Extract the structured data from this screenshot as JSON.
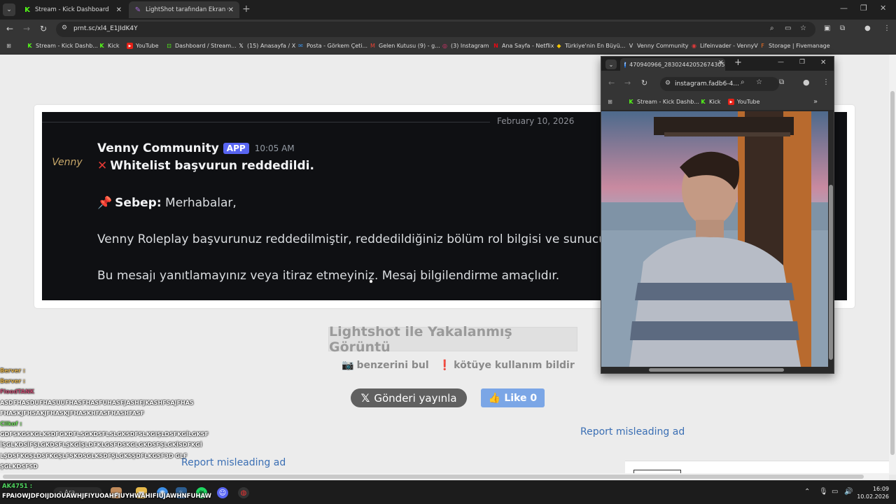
{
  "browser": {
    "tabs": [
      {
        "label": "Stream - Kick Dashboard"
      },
      {
        "label": "LightShot tarafından Ekran Görü"
      }
    ],
    "url": "prnt.sc/xl4_E1JIdK4Y",
    "bookmarks": [
      "Stream - Kick Dashb...",
      "Kick",
      "YouTube",
      "Dashboard / Stream...",
      "(15) Anasayfa / X",
      "Posta - Görkem Çeti...",
      "Gelen Kutusu (9) - g...",
      "(3) Instagram",
      "Ana Sayfa - Netflix",
      "Türkiye'nin En Büyü...",
      "Venny Community",
      "Lifeinvader - VennyV",
      "Storage | Fivemanage"
    ]
  },
  "screenshot": {
    "date": "February 10, 2026",
    "author": "Venny Community",
    "app_badge": "APP",
    "time": "10:05 AM",
    "avatar_text": "Venny",
    "line1": "Whitelist başvurun reddedildi.",
    "line2_label": "Sebep:",
    "line2_text": " Merhabalar,",
    "line3": "Venny Roleplay başvurunuz reddedilmiştir, reddedildiğiniz bölüm rol bilgisi ve sunucu kura",
    "line4": "Bu mesajı yanıtlamayınız veya itiraz etmeyiniz. Mesaj bilgilendirme amaçlıdır."
  },
  "lightshot": {
    "title": "Lightshot ile Yakalanmış Görüntü",
    "similar": "benzerini bul",
    "report_abuse": "kötüye kullanım bildir",
    "x_post": "Gönderi yayınla",
    "like": "Like",
    "like_count": "0",
    "report_ad_1": "Report misleading ad",
    "report_ad_2": "Report misleading ad"
  },
  "popup": {
    "tab_title": "470940966_28302442052674305...",
    "url": "instagram.fadb6-4...",
    "bookmarks": [
      "Stream - Kick Dashb...",
      "Kick",
      "YouTube"
    ]
  },
  "chat": {
    "lines": [
      {
        "user": "Berver :",
        "msg": ""
      },
      {
        "user": "Berver :",
        "msg": ""
      },
      {
        "user": "FloodTANK",
        "msg": ""
      },
      {
        "user": "",
        "msg": "ASDFHASDUFHASUUFHASFHASFUHASFJASHFJKASHFSAJFHAS"
      },
      {
        "user": "",
        "msg": "FHASKJFHSAKJFHASKJFHASKHFASFHASHFASF"
      },
      {
        "user": "Cilkof :",
        "msg": ""
      },
      {
        "user": "",
        "msg": "GDFSKGSKGLKSDFGKDFLSGKDSFLSLGKSDFSLKGIŞLDSFKGİLGKSF"
      },
      {
        "user": "",
        "msg": "İŞGLKDSİFŞLGKDSFLŞKGİŞLDFKLGSFDSKGLGKDSFŞLGKİSDFKGİ"
      },
      {
        "user": "",
        "msg": "LŞDSFKGŞLDSFKGŞLFSKDSGLKSDFŞLGKSŞDFLKGSF3D GLF"
      },
      {
        "user": "",
        "msg": "ŞGLKDSFSD"
      }
    ],
    "bottom_user": "AK4751 :",
    "bottom_msg": "FPAIOWJDFOIJDIOUAWHJFIYUOAHFIUYHWAHIFIUJAWHNFUHAW"
  },
  "taskbar": {
    "search_placeholder": "Ara",
    "time": "16:09",
    "date": "10.02.2026"
  },
  "colors": {
    "kick_green": "#53fc18",
    "discord_blurple": "#5865f2",
    "lightshot_link": "#3b6fb4",
    "like_blue": "#7ba6e6"
  }
}
